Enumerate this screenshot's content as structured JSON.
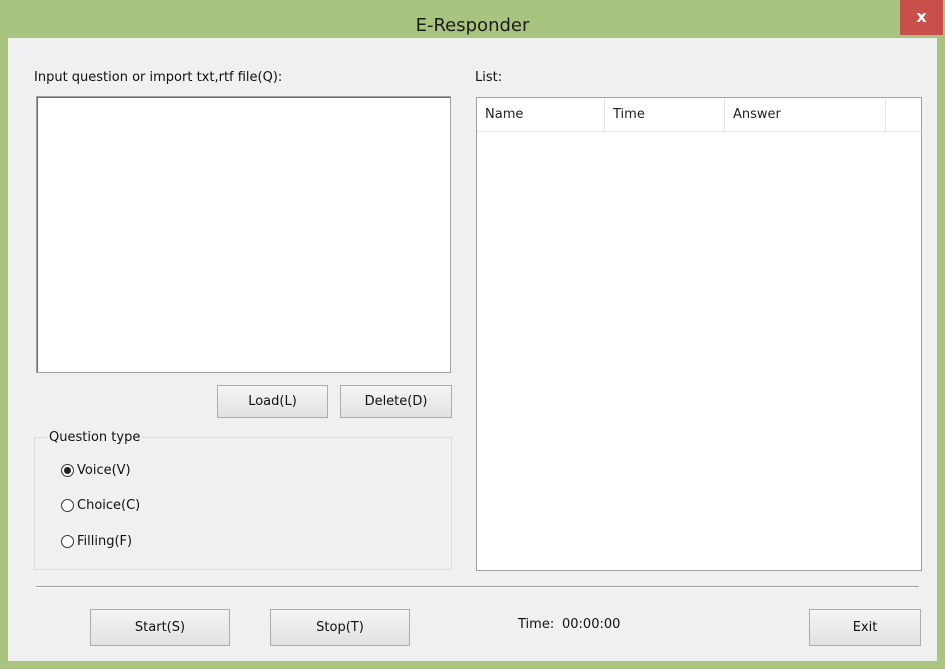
{
  "window": {
    "title": "E-Responder",
    "close_glyph": "x"
  },
  "left": {
    "input_label": "Input question or import txt,rtf file(Q):",
    "input_value": "",
    "load_button": "Load(L)",
    "delete_button": "Delete(D)",
    "question_type": {
      "title": "Question type",
      "options": [
        {
          "label": "Voice(V)",
          "checked": true
        },
        {
          "label": "Choice(C)",
          "checked": false
        },
        {
          "label": "Filling(F)",
          "checked": false
        }
      ]
    }
  },
  "right": {
    "list_label": "List:",
    "columns": [
      "Name",
      "Time",
      "Answer"
    ],
    "rows": []
  },
  "bottom": {
    "start_button": "Start(S)",
    "stop_button": "Stop(T)",
    "time_label": "Time:",
    "time_value": "00:00:00",
    "exit_button": "Exit"
  },
  "colors": {
    "frame": "#a9c47f",
    "close": "#c7504a",
    "client": "#f0f0f0"
  }
}
